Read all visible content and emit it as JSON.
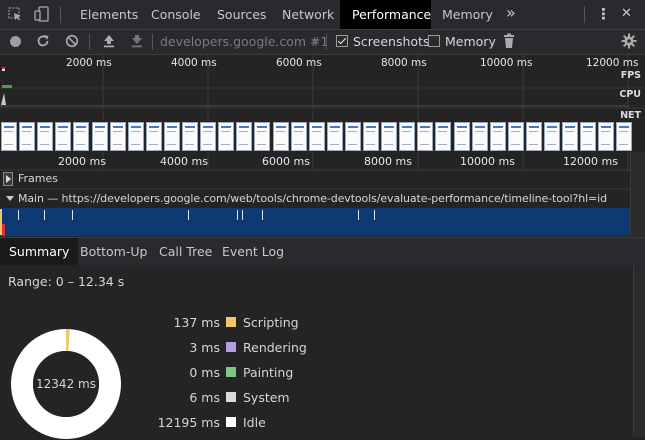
{
  "tabs": {
    "items": [
      {
        "label": "Elements"
      },
      {
        "label": "Console"
      },
      {
        "label": "Sources"
      },
      {
        "label": "Network"
      },
      {
        "label": "Performance"
      },
      {
        "label": "Memory"
      }
    ],
    "more": "»",
    "menu": "⋮",
    "close": "✕"
  },
  "toolbar": {
    "profile_select": "developers.google.com #1",
    "screenshots_label": "Screenshots",
    "screenshots_checked": true,
    "memory_label": "Memory",
    "memory_checked": false
  },
  "overview": {
    "ruler_labels": [
      "2000 ms",
      "4000 ms",
      "6000 ms",
      "8000 ms",
      "10000 ms",
      "12000 ms"
    ],
    "fps_label": "FPS",
    "cpu_label": "CPU",
    "net_label": "NET",
    "bottom_ruler_labels": [
      "2000 ms",
      "4000 ms",
      "6000 ms",
      "8000 ms",
      "10000 ms",
      "12000 ms"
    ]
  },
  "flame": {
    "frames_label": "Frames",
    "main_label": "Main — https://developers.google.com/web/tools/chrome-devtools/evaluate-performance/timeline-tool?hl=id"
  },
  "bottom_tabs": [
    "Summary",
    "Bottom-Up",
    "Call Tree",
    "Event Log"
  ],
  "summary": {
    "range": "Range: 0 – 12.34 s",
    "total": "12342 ms",
    "items": [
      {
        "value": "137 ms",
        "name": "Scripting",
        "color": "#f2c66d"
      },
      {
        "value": "3 ms",
        "name": "Rendering",
        "color": "#b59ce6"
      },
      {
        "value": "0 ms",
        "name": "Painting",
        "color": "#81c784"
      },
      {
        "value": "6 ms",
        "name": "System",
        "color": "#d9d9d9"
      },
      {
        "value": "12195 ms",
        "name": "Idle",
        "color": "#ffffff"
      }
    ]
  },
  "colors": {
    "accent_blue": "#0d3a73",
    "active_tab_bg": "#000000"
  }
}
